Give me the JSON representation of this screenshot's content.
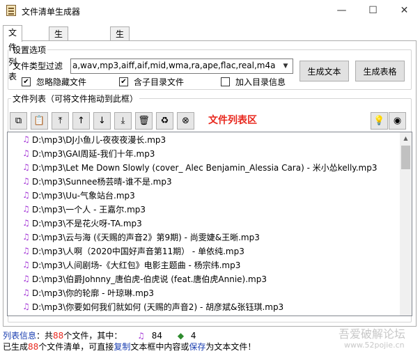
{
  "window": {
    "title": "文件清单生成器",
    "minimize_label": "—",
    "maximize_label": "☐",
    "close_label": "✕"
  },
  "tabs": [
    {
      "label": "文件列表"
    },
    {
      "label": "生成文本清单"
    },
    {
      "label": "生成信息表格"
    }
  ],
  "settings": {
    "legend": "设置选项",
    "filter_label": "文件类型过滤",
    "filter_value": "a,wav,mp3,aiff,aif,mid,wma,ra,ape,flac,real,m4a,m4r",
    "ignore_hidden": {
      "label": "忽略隐藏文件",
      "checked": true
    },
    "include_subdirs": {
      "label": "含子目录文件",
      "checked": true
    },
    "add_dir_info": {
      "label": "加入目录信息",
      "checked": false
    },
    "gen_text_label": "生成文本",
    "gen_table_label": "生成表格"
  },
  "filelist": {
    "legend": "文件列表（可将文件拖动到此框）",
    "area_label": "文件列表区",
    "tools": [
      "copy-file-icon",
      "paste-file-icon",
      "move-top-icon",
      "move-up-icon",
      "move-down-icon",
      "move-bottom-icon",
      "delete-icon",
      "clear-icon",
      "remove-file-icon",
      "bulb-icon",
      "preview-icon"
    ],
    "items": [
      "D:\\mp3\\DJ小鱼儿-夜夜夜漫长.mp3",
      "D:\\mp3\\GAI周延-我们十年.mp3",
      "D:\\mp3\\Let Me Down Slowly (cover_ Alec Benjamin_Alessia Cara) - 米小怂kelly.mp3",
      "D:\\mp3\\Sunnee杨芸晴-谁不是.mp3",
      "D:\\mp3\\Uu-气象站台.mp3",
      "D:\\mp3\\一个人 - 王嘉尔.mp3",
      "D:\\mp3\\不是花火呀-TA.mp3",
      "D:\\mp3\\云与海 (《天赐的声音2》第9期) - 尚雯婕&王晰.mp3",
      "D:\\mp3\\人啊（2020中国好声音第11期） - 单依纯.mp3",
      "D:\\mp3\\人间剧场-《大红包》电影主题曲 - 杨宗纬.mp3",
      "D:\\mp3\\伯爵Johnny_唐伯虎-伯虎说 (feat.唐伯虎Annie).mp3",
      "D:\\mp3\\你的轮廓 - 叶琼琳.mp3",
      "D:\\mp3\\你要如何我们就如何 (天赐的声音2) - 胡彦斌&张钰琪.mp3"
    ]
  },
  "status": {
    "line1_label": "列表信息",
    "line1_prefix": "：共",
    "file_count": "88",
    "line1_suffix": "个文件，其中：",
    "music_count": "84",
    "other_count": "4",
    "line2_prefix": "已生成",
    "gen_count": "88",
    "line2_mid1": "个文件清单，可直接",
    "copy_word": "复制",
    "line2_mid2": "文本框中内容或",
    "save_word": "保存",
    "line2_suffix": "为文本文件！"
  },
  "watermark": {
    "text": "吾爱破解论坛",
    "url": "www.52pojie.cn"
  }
}
